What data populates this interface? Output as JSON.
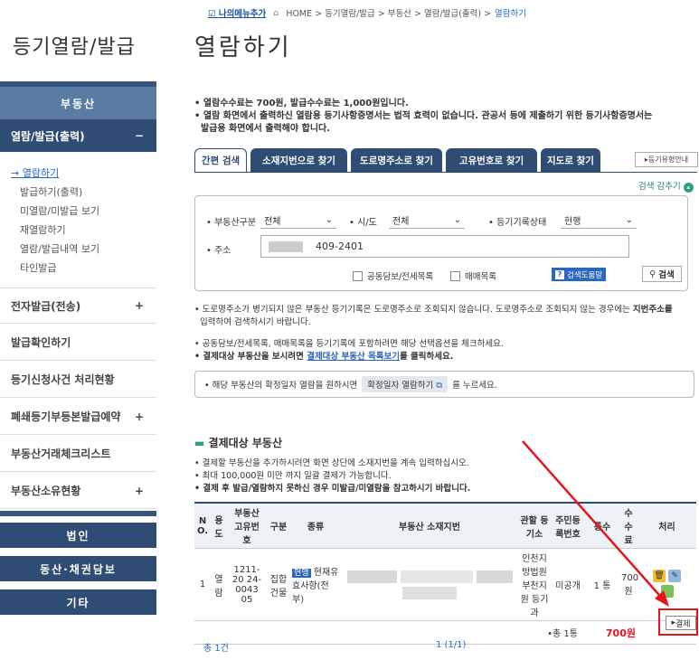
{
  "top": {
    "my_menu": "나의메뉴추가",
    "crumbs": "HOME > 등기열람/발급 > 부동산 > 열람/발급(출력) >",
    "current": "열람하기"
  },
  "sidebar": {
    "title": "등기열람/발급",
    "main": "부동산",
    "sub": "열람/발급(출력)",
    "sub_toggle": "−",
    "links": [
      "열람하기",
      "발급하기(출력)",
      "미열람/미발급 보기",
      "재열람하기",
      "열람/발급내역 보기",
      "타인발급"
    ],
    "active_marker": "→",
    "rows": [
      {
        "label": "전자발급(전송)",
        "toggle": "+"
      },
      {
        "label": "발급확인하기",
        "toggle": ""
      },
      {
        "label": "등기신청사건 처리현황",
        "toggle": ""
      },
      {
        "label": "폐쇄등기부등본발급예약",
        "toggle": "+"
      },
      {
        "label": "부동산거래체크리스트",
        "toggle": ""
      },
      {
        "label": "부동산소유현황",
        "toggle": "+"
      }
    ],
    "buttons": [
      "법인",
      "동산·채권담보",
      "기타"
    ]
  },
  "main": {
    "title": "열람하기",
    "notes": [
      "열람수수료는 700원, 발급수수료는 1,000원입니다.",
      "열람 화면에서 출력하신 열람용 등기사항증명서는 법적 효력이 없습니다. 관공서 등에 제출하기 위한 등기사항증명서는",
      "발급용 화면에서 출력해야 합니다."
    ],
    "tabs": [
      "간편 검색",
      "소재지번으로 찾기",
      "도로명주소로 찾기",
      "고유번호로 찾기",
      "지도로 찾기"
    ],
    "guide": "등기유형안내",
    "collapse": "검색 감추기"
  },
  "search": {
    "type_label": "부동산구분",
    "type_value": "전체",
    "sido_label": "시/도",
    "sido_value": "전체",
    "status_label": "등기기록상태",
    "status_value": "현행",
    "addr_label": "주소",
    "addr_value": "409-2401",
    "check1": "공동담보/전세목록",
    "check2": "매매목록",
    "help": "검색도움말",
    "search_btn": "검색"
  },
  "info": {
    "lines": [
      "도로명주소가 병기되지 않은 부동산 등기기록은 도로명주소로 조회되지 않습니다. 도로명주소로 조회되지 않는 경우에는",
      "지번주소를",
      "입력하여 검색하시기 바랍니다.",
      "공동담보/전세목록, 매매목록을 등기기록에 포함하려면 해당 선택옵션을 체크하세요.",
      "결제대상 부동산을 보시려면",
      "결제대상 부동산 목록보기",
      "를 클릭하세요."
    ],
    "confirm_pre": "해당 부동산의 확정일자 열람을 원하시면",
    "confirm_btn": "확정일자 열람하기",
    "confirm_post": "를 누르세요."
  },
  "payment": {
    "title": "결제대상 부동산",
    "notes": [
      "결제할 부동산을 추가하시려면 화면 상단에 소재지번을 계속 입력하십시오.",
      "최대 100,000원 미만 까지 일괄 결제가 가능합니다.",
      "결제 후 발급/열람하지 못하신 경우 미발급/미열람을 참고하시기 바랍니다."
    ],
    "headers": [
      "N O.",
      "용 도",
      "부동산 고유번 호",
      "구분",
      "종류",
      "부동산 소재지번",
      "관할 등기소",
      "주민등 록번호",
      "통수",
      "수 수 료",
      "처리"
    ],
    "row": {
      "no": "1",
      "use": "열 람",
      "id": "1211-20 24-0043 05",
      "kind": "집합 건물",
      "badge": "현행",
      "type": "현재유 효사항(전부)",
      "office": "인천지 방법원 부천지 원 등기 과",
      "resident": "미공개",
      "count": "1 통",
      "fee": "700 원"
    },
    "total_count": "•총 1통",
    "total_fee": "700원",
    "pay_btn": "결제",
    "footer_count": "총 1건",
    "page": "1  (1/1)"
  },
  "colors": {
    "navy": "#2e4c74",
    "accent_red": "#e8141b",
    "link": "#2b66c2"
  }
}
